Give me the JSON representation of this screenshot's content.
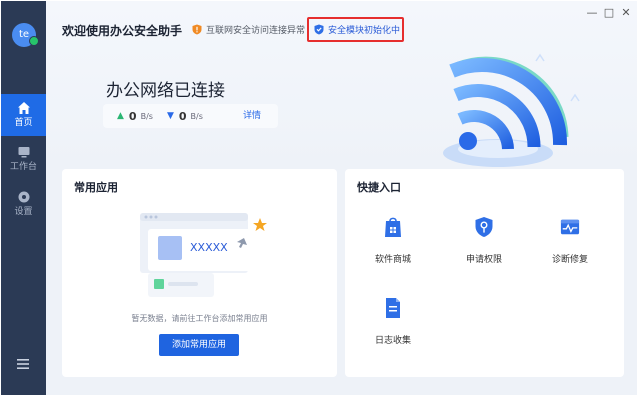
{
  "sidebar": {
    "avatar_text": "te",
    "items": [
      {
        "label": "首页",
        "icon": "home-icon",
        "active": true
      },
      {
        "label": "工作台",
        "icon": "monitor-icon",
        "active": false
      },
      {
        "label": "设置",
        "icon": "gear-icon",
        "active": false
      }
    ],
    "menu_icon": "menu-icon"
  },
  "header": {
    "title": "欢迎使用办公安全助手",
    "alert_internet": "互联网安全访问连接异常",
    "alert_module": "安全模块初始化中"
  },
  "window": {
    "minimize": "—",
    "maximize": "□",
    "close": "✕"
  },
  "network": {
    "status": "办公网络已连接",
    "upload_value": "0",
    "upload_unit": "B/s",
    "download_value": "0",
    "download_unit": "B/s",
    "details_link": "详情"
  },
  "common_apps": {
    "title": "常用应用",
    "placeholder_app": "XXXXX",
    "empty_text": "暂无数据，请前往工作台添加常用应用",
    "add_button": "添加常用应用"
  },
  "quick_entry": {
    "title": "快捷入口",
    "items": [
      {
        "label": "软件商城",
        "icon": "store-icon"
      },
      {
        "label": "申请权限",
        "icon": "permission-key-icon"
      },
      {
        "label": "诊断修复",
        "icon": "diagnose-icon"
      },
      {
        "label": "日志收集",
        "icon": "log-icon"
      }
    ]
  },
  "colors": {
    "sidebar": "#2b3a55",
    "accent": "#1f64e0",
    "highlight_border": "#e62e2e",
    "warning": "#f08a24"
  }
}
